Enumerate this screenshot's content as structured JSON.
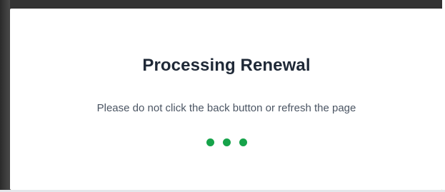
{
  "modal": {
    "title": "Processing Renewal",
    "message": "Please do not click the back button or refresh the page"
  },
  "loader": {
    "dot_count": 3,
    "color": "#16a34a"
  },
  "colors": {
    "title": "#1f2937",
    "message": "#4b5563",
    "backdrop": "#3a3a3a"
  },
  "icons": [
    "loading-dots-icon"
  ]
}
